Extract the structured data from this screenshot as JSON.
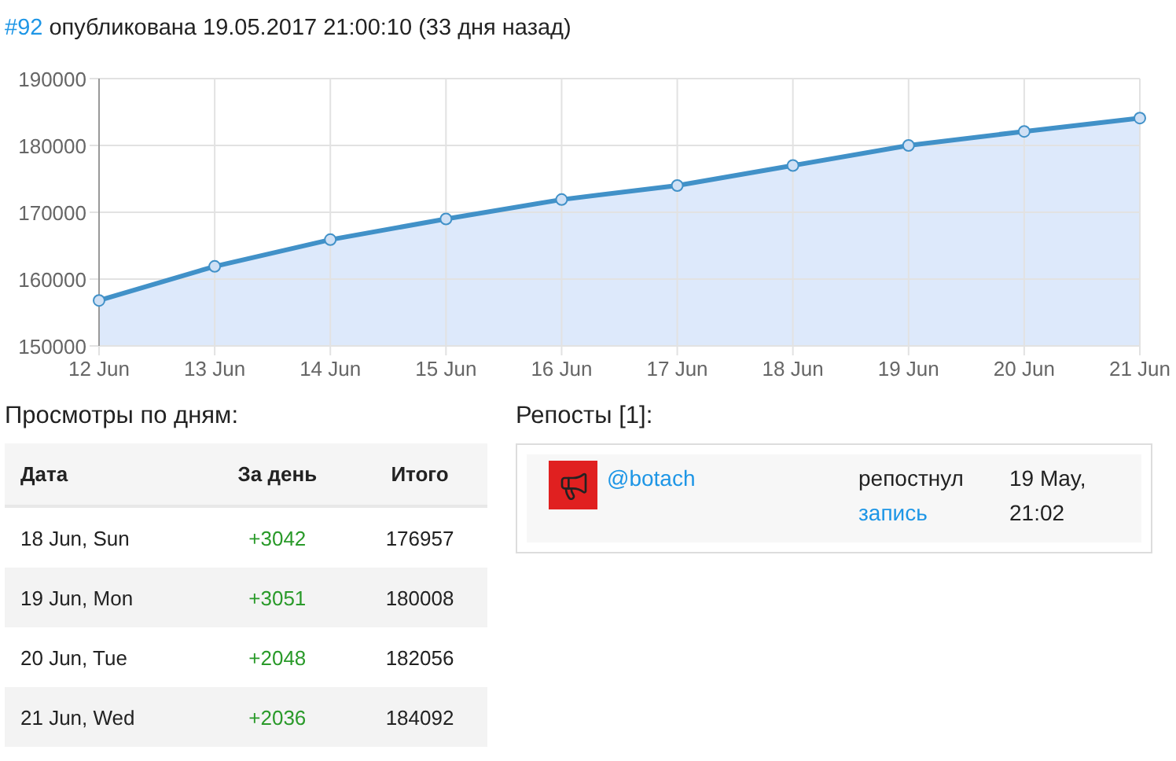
{
  "post": {
    "number": "#92",
    "published": "опубликована 19.05.2017 21:00:10 (33 дня назад)"
  },
  "chart_data": {
    "type": "area",
    "categories": [
      "12 Jun",
      "13 Jun",
      "14 Jun",
      "15 Jun",
      "16 Jun",
      "17 Jun",
      "18 Jun",
      "19 Jun",
      "20 Jun",
      "21 Jun"
    ],
    "ylim": [
      150000,
      190000
    ],
    "grid": true,
    "yticks": [
      150000,
      160000,
      170000,
      180000,
      190000
    ],
    "series": [
      {
        "color": "#4191c8",
        "values": [
          156800,
          161900,
          165900,
          169000,
          171900,
          174000,
          177000,
          180000,
          182100,
          184100
        ]
      }
    ]
  },
  "daily": {
    "title": "Просмотры по дням:",
    "columns": [
      "Дата",
      "За день",
      "Итого"
    ],
    "rows": [
      {
        "date": "18 Jun, Sun",
        "delta": "+3042",
        "total": "176957"
      },
      {
        "date": "19 Jun, Mon",
        "delta": "+3051",
        "total": "180008"
      },
      {
        "date": "20 Jun, Tue",
        "delta": "+2048",
        "total": "182056"
      },
      {
        "date": "21 Jun, Wed",
        "delta": "+2036",
        "total": "184092"
      }
    ]
  },
  "reposts": {
    "title": "Репосты [1]:",
    "items": [
      {
        "channel": "@botach",
        "action": "репостнул",
        "link": "запись",
        "date": "19 May,",
        "time": "21:02"
      }
    ]
  }
}
